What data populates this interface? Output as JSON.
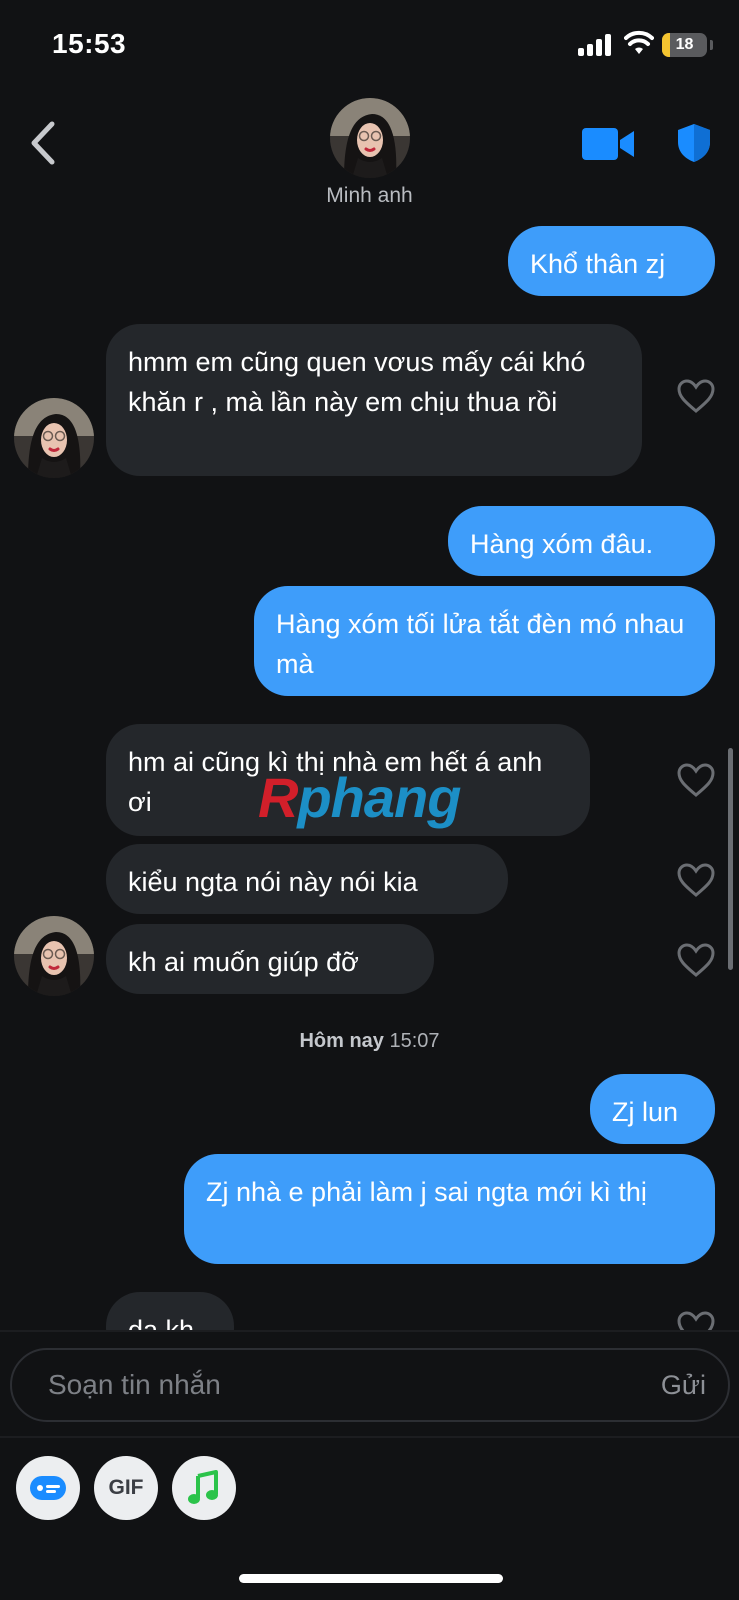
{
  "status_bar": {
    "time": "15:53",
    "battery": "18",
    "battery_level": 0.18
  },
  "header": {
    "contact_name": "Minh anh",
    "back_icon": "chevron-left-icon",
    "video_icon": "video-camera-icon",
    "safety_icon": "shield-icon"
  },
  "colors": {
    "background": "#111214",
    "outgoing_bubble": "#3e9dfa",
    "incoming_bubble": "#24272b",
    "accent": "#1a8cff"
  },
  "messages": [
    {
      "text": "Khổ thân zj",
      "direction": "outgoing"
    },
    {
      "text": "hmm em cũng quen vơus mấy cái khó khăn r , mà lần này em chịu thua rồi",
      "direction": "incoming"
    },
    {
      "text": "Hàng xóm đâu.",
      "direction": "outgoing"
    },
    {
      "text": "Hàng xóm tối lửa tắt đèn mó nhau mà",
      "direction": "outgoing"
    },
    {
      "text": "hm ai cũng kì thị nhà em hết á anh ơi",
      "direction": "incoming"
    },
    {
      "text": "kiểu ngta nói này nói kia",
      "direction": "incoming"
    },
    {
      "text": "kh ai muốn giúp đỡ",
      "direction": "incoming"
    },
    {
      "text": "Zj lun",
      "direction": "outgoing"
    },
    {
      "text": "Zj nhà e phải làm j sai ngta mới kì thị",
      "direction": "outgoing"
    },
    {
      "text": "dạ kh",
      "direction": "incoming"
    }
  ],
  "timestamp": {
    "day": "Hôm nay",
    "time": "15:07"
  },
  "watermark": {
    "part1": "R",
    "part2": "phang"
  },
  "composer": {
    "placeholder": "Soạn tin nhắn",
    "send_label": "Gửi"
  },
  "toolbar": {
    "gif_label": "GIF",
    "sticker_icon": "sticker-icon",
    "music_icon": "music-note-icon"
  }
}
